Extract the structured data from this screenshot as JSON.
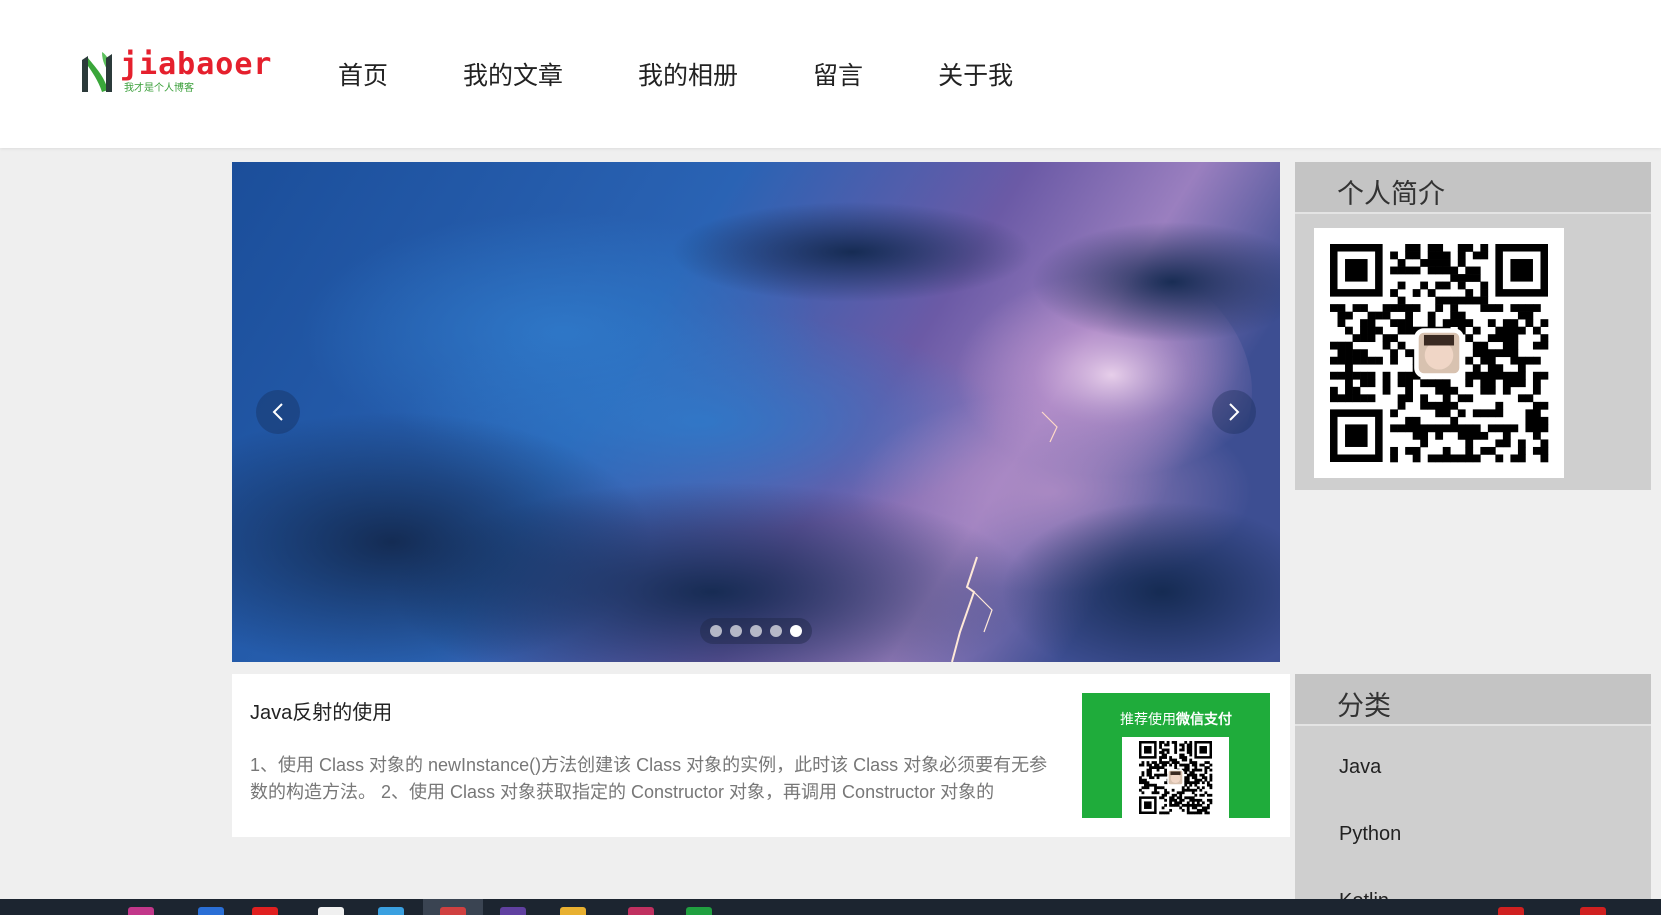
{
  "header": {
    "logo": {
      "wordmark": "jiabaoer",
      "tagline": "我才是个人博客"
    },
    "nav": [
      {
        "label": "首页"
      },
      {
        "label": "我的文章"
      },
      {
        "label": "我的相册"
      },
      {
        "label": "留言"
      },
      {
        "label": "关于我"
      }
    ]
  },
  "carousel": {
    "slide_count": 5,
    "active_slide": 5,
    "prev_icon": "chevron-left-icon",
    "next_icon": "chevron-right-icon"
  },
  "article": {
    "title": "Java反射的使用",
    "excerpt": "1、使用 Class 对象的 newInstance()方法创建该 Class 对象的实例，此时该 Class 对象必须要有无参数的构造方法。 2、使用 Class 对象获取指定的 Constructor 对象，再调用 Constructor 对象的 newInstance() 方法创建实例",
    "pay": {
      "label_prefix": "推荐使用",
      "label_bold": "微信支付"
    }
  },
  "sidebar": {
    "profile": {
      "title": "个人简介"
    },
    "categories": {
      "title": "分类",
      "items": [
        {
          "label": "Java"
        },
        {
          "label": "Python"
        },
        {
          "label": "Kotlin"
        }
      ]
    }
  },
  "colors": {
    "accent_green": "#1fac3b",
    "logo_red": "#e5202d",
    "page_bg": "#efefef",
    "sidebar_bg": "#cfcfcf"
  }
}
